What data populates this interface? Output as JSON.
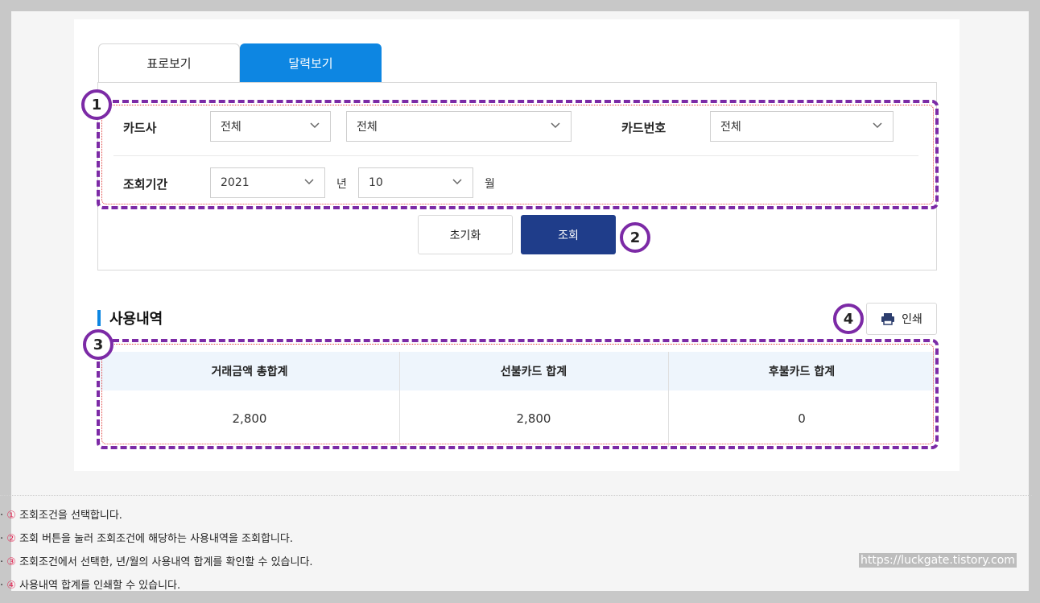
{
  "tabs": {
    "table_view": "표로보기",
    "calendar_view": "달력보기"
  },
  "filters": {
    "card_company_label": "카드사",
    "card_company_value": "전체",
    "card_product_value": "전체",
    "card_number_label": "카드번호",
    "card_number_value": "전체",
    "period_label": "조회기간",
    "year_value": "2021",
    "year_unit": "년",
    "month_value": "10",
    "month_unit": "월"
  },
  "buttons": {
    "reset": "초기화",
    "search": "조회",
    "print": "인쇄"
  },
  "markers": {
    "m1": "1",
    "m2": "2",
    "m3": "3",
    "m4": "4"
  },
  "section": {
    "title": "사용내역"
  },
  "table": {
    "headers": [
      "거래금액 총합계",
      "선불카드 합계",
      "후불카드 합계"
    ],
    "values": [
      "2,800",
      "2,800",
      "0"
    ]
  },
  "notes": [
    {
      "bullet": "·",
      "num": "①",
      "text": "조회조건을 선택합니다."
    },
    {
      "bullet": "·",
      "num": "②",
      "text": "조회 버튼을 눌러 조회조건에 해당하는 사용내역을 조회합니다."
    },
    {
      "bullet": "·",
      "num": "③",
      "text": "조회조건에서 선택한, 년/월의 사용내역 합계를 확인할 수 있습니다."
    },
    {
      "bullet": "·",
      "num": "④",
      "text": "사용내역 합계를 인쇄할 수 있습니다."
    }
  ],
  "watermark": "https://luckgate.tistory.com",
  "colors": {
    "tab_active": "#0d86e2",
    "search_button": "#1f3d8a",
    "annotation": "#7c2aa6",
    "table_header_bg": "#eef5fc"
  },
  "icons": {
    "dropdown": "chevron-down-icon",
    "print": "printer-icon"
  }
}
